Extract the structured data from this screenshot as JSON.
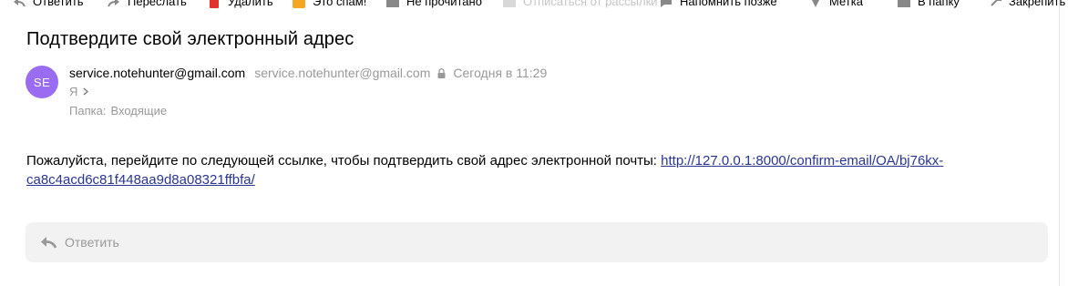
{
  "toolbar": {
    "items": [
      {
        "label": "Ответить"
      },
      {
        "label": "Переслать"
      },
      {
        "label": "Удалить"
      },
      {
        "label": "Это спам!"
      },
      {
        "label": "Не прочитано"
      },
      {
        "label": "Отписаться от рассылки"
      },
      {
        "label": "Напомнить позже"
      },
      {
        "label": "Метка"
      },
      {
        "label": "В папку"
      },
      {
        "label": "Закрепить"
      }
    ]
  },
  "message": {
    "subject": "Подтвердите свой электронный адрес",
    "avatar_initials": "SE",
    "avatar_color": "#9a6cf2",
    "sender_name": "service.notehunter@gmail.com",
    "sender_email": "service.notehunter@gmail.com",
    "timestamp": "Сегодня в 11:29",
    "recipient": "Я",
    "folder_label": "Папка:",
    "folder_name": "Входящие",
    "body_text": "Пожалуйста, перейдите по следующей ссылке, чтобы подтвердить свой адрес электронной почты: ",
    "link_text": "http://127.0.0.1:8000/confirm-email/OA/bj76kx-ca8c4acd6c81f448aa9d8a08321ffbfa/",
    "link_color": "#2a3593"
  },
  "reply": {
    "label": "Ответить"
  }
}
